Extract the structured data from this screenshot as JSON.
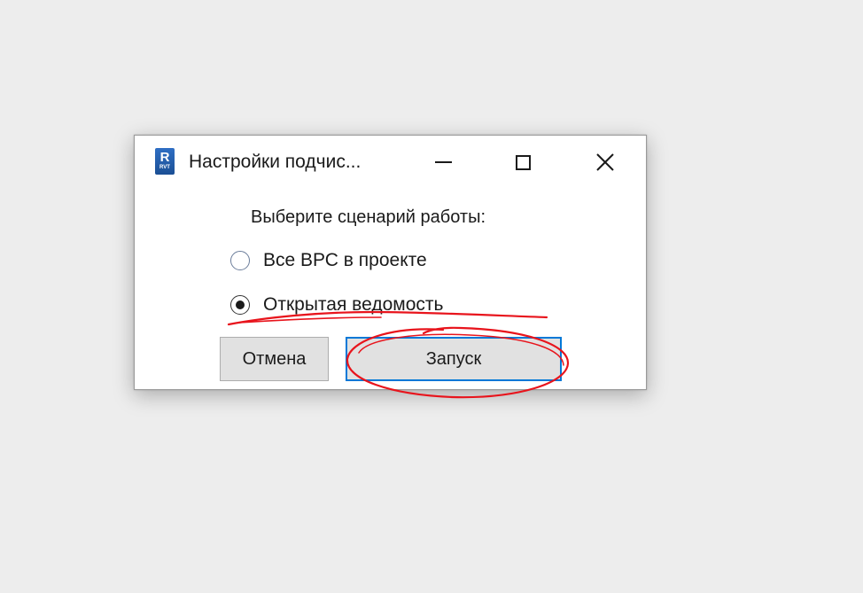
{
  "window": {
    "title": "Настройки подчис...",
    "icon": {
      "name": "revit-app-icon",
      "letter": "R",
      "sub": "RVT"
    },
    "controls": {
      "minimize": "minimize-icon",
      "maximize": "maximize-icon",
      "close": "close-icon"
    }
  },
  "dialog": {
    "prompt": "Выберите сценарий работы:",
    "options": [
      {
        "label": "Все ВРС в проекте",
        "checked": false
      },
      {
        "label": "Открытая ведомость",
        "checked": true
      }
    ],
    "buttons": {
      "cancel": "Отмена",
      "run": "Запуск"
    }
  },
  "colors": {
    "annotation": "#e8141c",
    "focus_border": "#0078d7",
    "button_face": "#e1e1e1"
  }
}
